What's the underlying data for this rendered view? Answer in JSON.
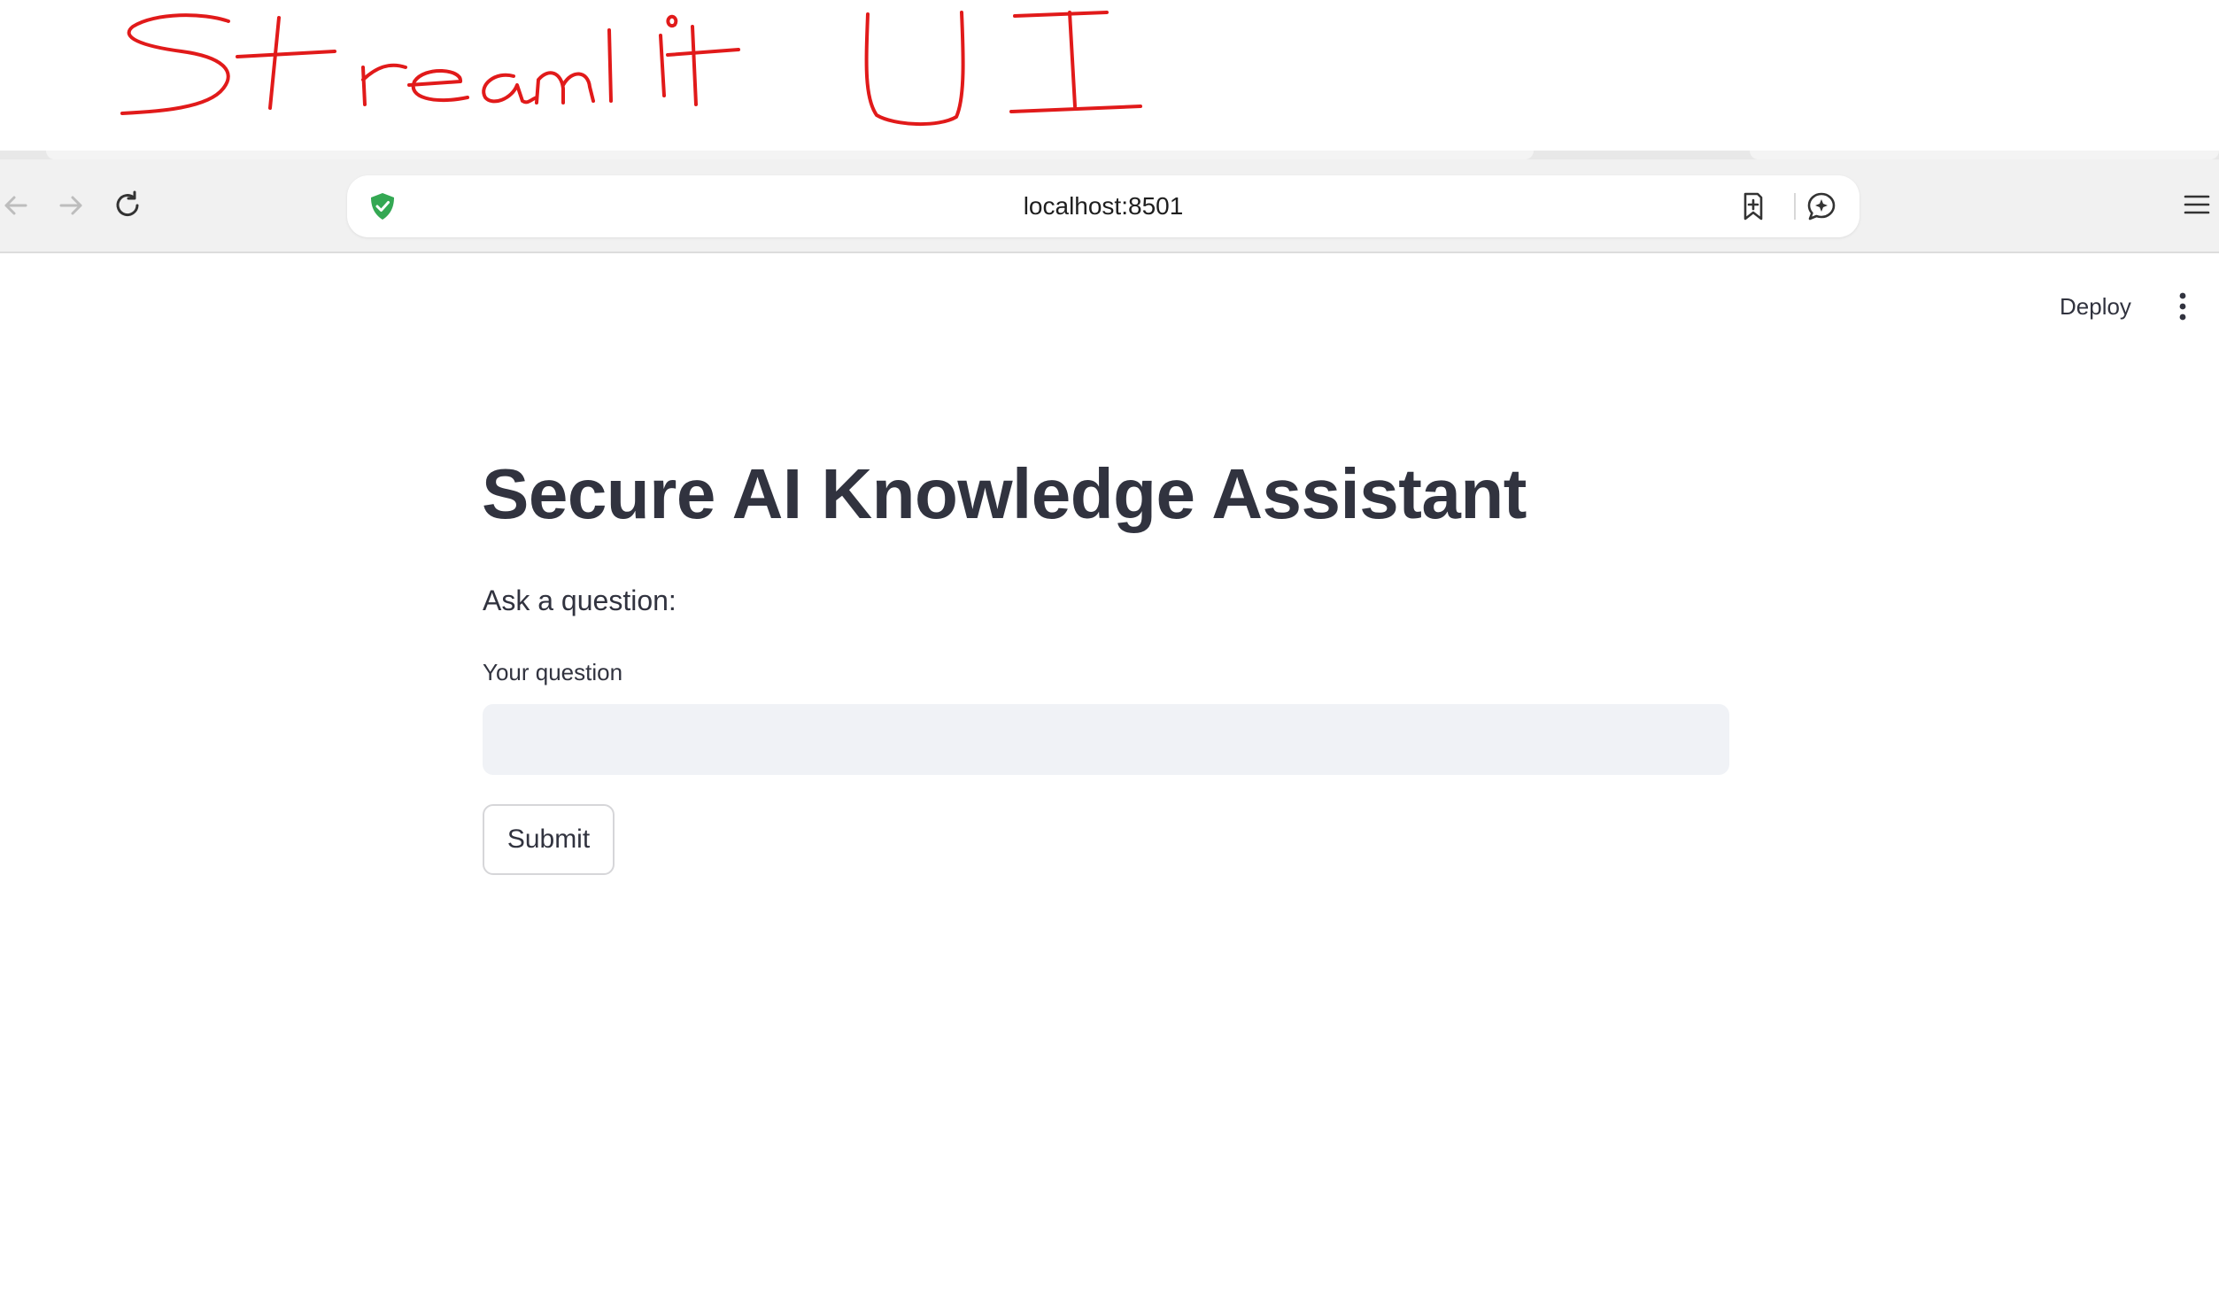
{
  "annotation": {
    "handwritten_text": "Streamlit UI",
    "ink_color": "#e11a1a"
  },
  "browser": {
    "url": "localhost:8501",
    "icons": {
      "back": "arrow-left-icon",
      "forward": "arrow-right-icon",
      "reload": "reload-icon",
      "security": "shield-check-icon",
      "bookmark": "bookmark-add-icon",
      "assistant": "sparkle-chat-icon",
      "menu": "hamburger-menu-icon"
    },
    "shield_color": "#34a853"
  },
  "streamlit": {
    "toolbar": {
      "deploy_label": "Deploy",
      "more_icon": "vertical-dots-icon"
    },
    "title": "Secure AI Knowledge Assistant",
    "prompt": "Ask a question:",
    "input": {
      "label": "Your question",
      "value": "",
      "placeholder": ""
    },
    "submit_label": "Submit"
  },
  "colors": {
    "text": "#31333f",
    "input_background": "#f0f2f6",
    "button_border": "#d6d6d9"
  }
}
